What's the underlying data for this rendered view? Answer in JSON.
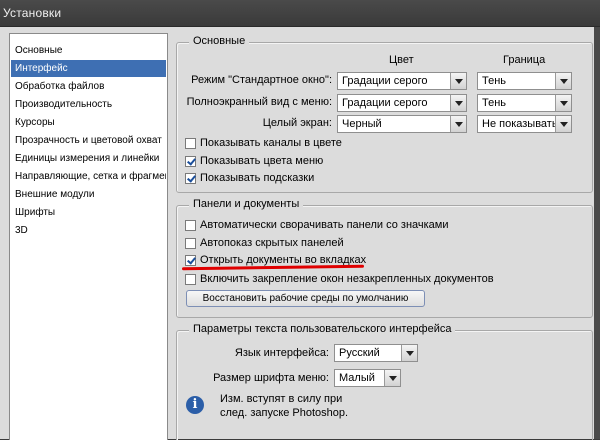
{
  "window": {
    "title": "Установки"
  },
  "sidebar": {
    "items": [
      {
        "label": "Основные"
      },
      {
        "label": "Интерфейс",
        "selected": true
      },
      {
        "label": "Обработка файлов"
      },
      {
        "label": "Производительность"
      },
      {
        "label": "Курсоры"
      },
      {
        "label": "Прозрачность и цветовой охват"
      },
      {
        "label": "Единицы измерения и линейки"
      },
      {
        "label": "Направляющие, сетка и фрагменты"
      },
      {
        "label": "Внешние модули"
      },
      {
        "label": "Шрифты"
      },
      {
        "label": "3D"
      }
    ]
  },
  "general": {
    "title": "Основные",
    "col_color": "Цвет",
    "col_border": "Граница",
    "rows": [
      {
        "label": "Режим \"Стандартное окно\":",
        "color": "Градации серого",
        "border": "Тень"
      },
      {
        "label": "Полноэкранный вид с меню:",
        "color": "Градации серого",
        "border": "Тень"
      },
      {
        "label": "Целый экран:",
        "color": "Черный",
        "border": "Не показывать"
      }
    ],
    "checkboxes": [
      {
        "label": "Показывать каналы в цвете",
        "checked": false
      },
      {
        "label": "Показывать цвета меню",
        "checked": true
      },
      {
        "label": "Показывать подсказки",
        "checked": true
      }
    ]
  },
  "panels": {
    "title": "Панели и документы",
    "checkboxes": [
      {
        "label": "Автоматически сворачивать панели со значками",
        "checked": false
      },
      {
        "label": "Автопоказ скрытых панелей",
        "checked": false
      },
      {
        "label": "Открыть документы во вкладках",
        "checked": true
      },
      {
        "label": "Включить закрепление окон незакрепленных документов",
        "checked": false
      }
    ],
    "restore_button": "Восстановить рабочие среды по умолчанию"
  },
  "text_ui": {
    "title": "Параметры текста пользовательского интерфейса",
    "language_label": "Язык интерфейса:",
    "language_value": "Русский",
    "fontsize_label": "Размер шрифта меню:",
    "fontsize_value": "Малый",
    "note_line1": "Изм. вступят в силу при",
    "note_line2": "след. запуске Photoshop."
  },
  "colors": {
    "selection": "#3e6fb3",
    "highlight_underline": "#e00000"
  }
}
